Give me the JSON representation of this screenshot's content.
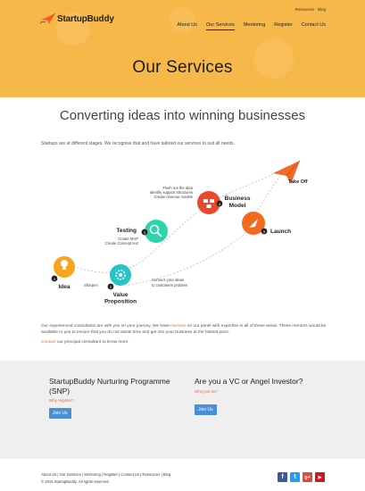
{
  "brand": {
    "name": "StartupBuddy",
    "accent": "#f26a2a",
    "hero_bg": "#f7b84a",
    "button_color": "#4a8fd6"
  },
  "utility_nav": {
    "resources": "Resources",
    "separator": " · ",
    "blog": "Blog"
  },
  "main_nav": [
    {
      "label": "About Us"
    },
    {
      "label": "Our Services",
      "active": true
    },
    {
      "label": "Mentoring"
    },
    {
      "label": "Register"
    },
    {
      "label": "Contact Us"
    }
  ],
  "hero": {
    "title": "Our Services"
  },
  "tagline": "Converting ideas into winning businesses",
  "intro": "Startups are at different stages. We recognise that and have tailored our services to suit all needs.",
  "diagram": {
    "stages": [
      {
        "number": "1",
        "label": "Idea"
      },
      {
        "number": "2",
        "label_line1": "Value",
        "label_line2": "Proposition"
      },
      {
        "number": "3",
        "label": "Testing"
      },
      {
        "number": "4",
        "label_line1": "Business",
        "label_line2": "Model"
      },
      {
        "number": "5",
        "label": "Launch"
      }
    ],
    "sharpen": "Sharpen",
    "connect_lines": [
      "Connect your ideas",
      "to customers problem"
    ],
    "testing_lines": [
      "Create MVP",
      "Create Concept text"
    ],
    "bm_lines": [
      "Flesh out the Idea",
      "Identify support structures",
      "Create revenue models"
    ],
    "take_off": "Take Off"
  },
  "body": {
    "para_pre": "Our experienced consultants are with you on your journey. We have ",
    "para_link": "mentors",
    "para_post": " on our panel with expertise in all of these areas. These mentors would be available to you to ensure that you do not waste time and get into your business at the fastest pace.",
    "contact_link": "Contact",
    "contact_rest": " our principal consultant to know more."
  },
  "cta": {
    "left": {
      "title": "StartupBuddy Nurturing Programme (SNP)",
      "sub": "Why register?",
      "button": "Join Us"
    },
    "right": {
      "title": "Are you a VC or Angel Investor?",
      "sub": "Why join us?",
      "button": "Join Us"
    }
  },
  "footer": {
    "links": "About Us | Our Services | Mentoring | Register | Contact Us | Resources | Blog",
    "copyright": "© 2015 StartupBuddy. All rights reserved."
  },
  "social": [
    {
      "icon": "facebook-icon",
      "glyph": "f",
      "color": "#3b5998"
    },
    {
      "icon": "twitter-icon",
      "glyph": "t",
      "color": "#1da1f2"
    },
    {
      "icon": "google-plus-icon",
      "glyph": "g+",
      "color": "#dd4b39"
    },
    {
      "icon": "youtube-icon",
      "glyph": "▶",
      "color": "#cc181e"
    }
  ]
}
